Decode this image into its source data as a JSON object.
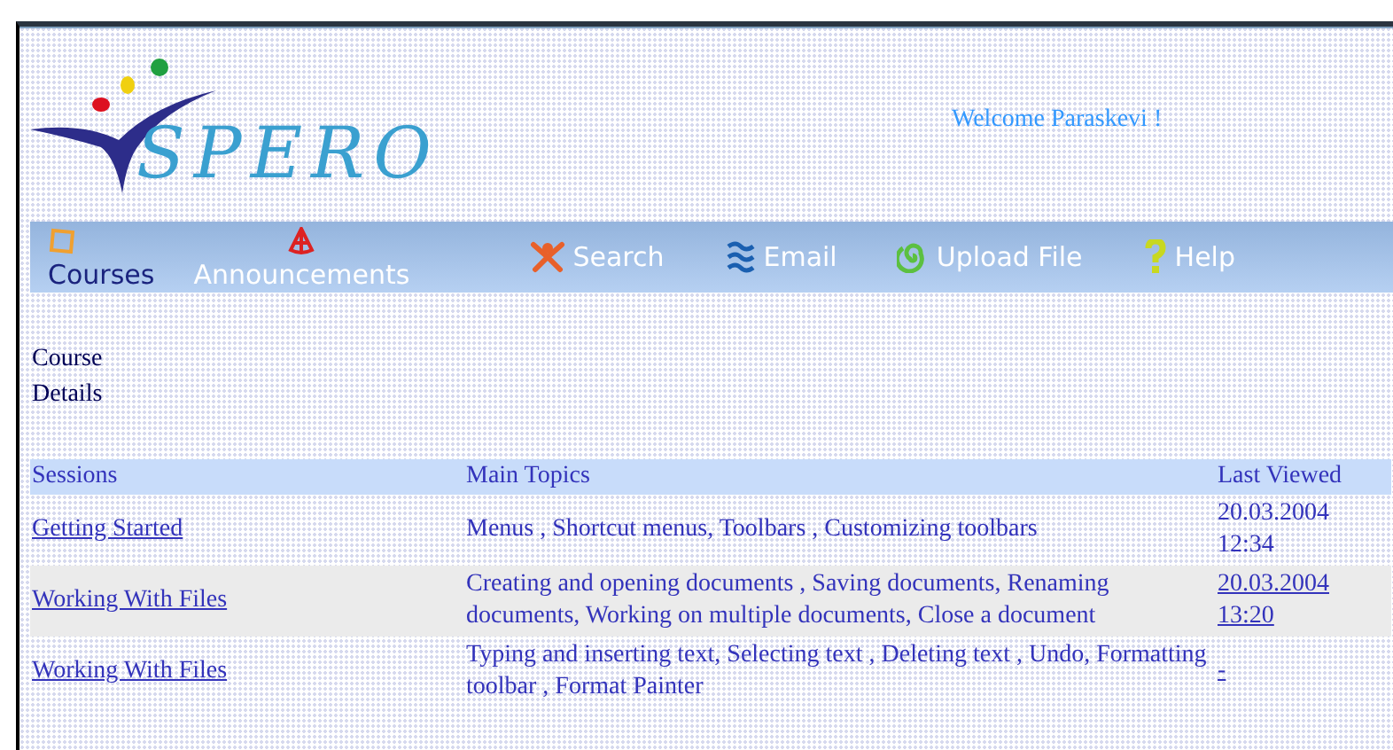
{
  "logo": {
    "text": "SPERO"
  },
  "welcome": "Welcome Paraskevi !",
  "nav": [
    {
      "label": "Courses",
      "kind": "stacked",
      "selected": true
    },
    {
      "label": "Announcements",
      "kind": "stacked",
      "selected": false
    },
    {
      "label": "Search",
      "kind": "inline",
      "selected": false
    },
    {
      "label": "Email",
      "kind": "inline",
      "selected": false
    },
    {
      "label": "Upload File",
      "kind": "inline",
      "selected": false
    },
    {
      "label": "Help",
      "kind": "inline",
      "selected": false
    }
  ],
  "section_title": "Course Details",
  "table": {
    "columns": [
      "Sessions",
      "Main Topics",
      "Last Viewed"
    ],
    "rows": [
      {
        "session": "Getting Started",
        "topics": "Menus , Shortcut menus, Toolbars , Customizing toolbars",
        "last_viewed": "20.03.2004 12:34",
        "last_viewed_linked": false,
        "shaded": false
      },
      {
        "session": "Working With Files",
        "topics": "Creating and opening documents , Saving documents, Renaming documents, Working on multiple documents, Close a document",
        "last_viewed": "20.03.2004 13:20",
        "last_viewed_linked": true,
        "shaded": true
      },
      {
        "session": "Working With Files",
        "topics": "Typing and inserting text, Selecting text , Deleting text , Undo, Formatting toolbar , Format Painter",
        "last_viewed": "-",
        "last_viewed_linked": true,
        "shaded": false
      }
    ]
  }
}
